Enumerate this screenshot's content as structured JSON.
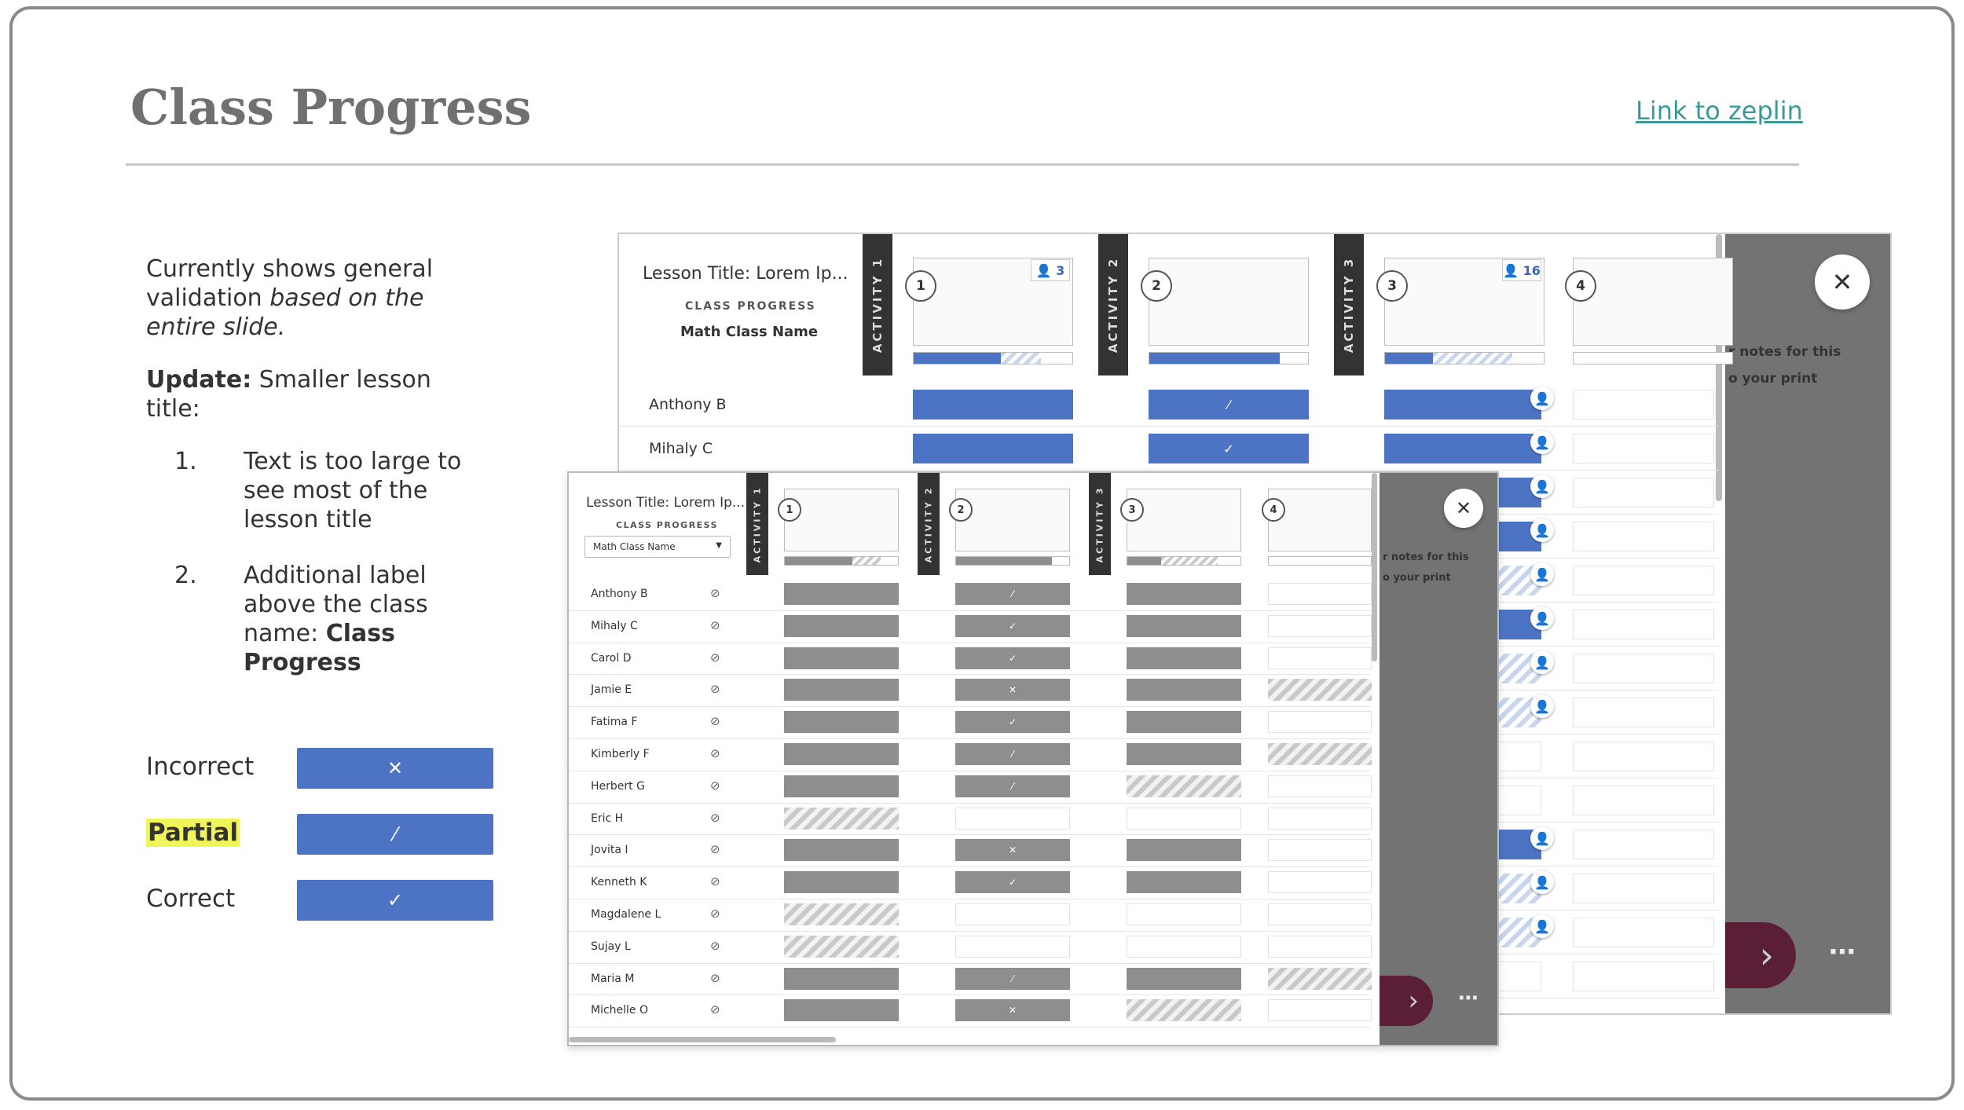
{
  "slide": {
    "title": "Class Progress",
    "link": "Link to zeplin"
  },
  "notes": {
    "p1a": "Currently shows general validation ",
    "p1b": "based on the entire slide.",
    "update_bold": "Update:",
    "update_text": " Smaller lesson title:",
    "items": [
      {
        "num": "1.",
        "text": "Text is too large to see most of the lesson title"
      },
      {
        "num": "2.",
        "text_a": "Additional label above the class name: ",
        "text_b": "Class Progress"
      }
    ]
  },
  "legend": [
    {
      "label": "Incorrect",
      "icon": "x-icon",
      "glyph": "✕"
    },
    {
      "label": "Partial",
      "icon": "slash-icon",
      "glyph": "⁄"
    },
    {
      "label": "Correct",
      "icon": "check-icon",
      "glyph": "✓"
    }
  ],
  "back_screen": {
    "lesson_title": "Lesson Title: Lorem Ip...",
    "sub_label": "CLASS PROGRESS",
    "class_name": "Math Class Name",
    "activities": [
      "ACTIVITY 1",
      "ACTIVITY 2",
      "ACTIVITY 3"
    ],
    "problems": [
      {
        "num": "1",
        "count": "3",
        "progress": 0.55,
        "partial": 0.25
      },
      {
        "num": "2",
        "progress": 0.82,
        "partial": 0
      },
      {
        "num": "3",
        "count": "16",
        "progress": 0.3,
        "partial": 0.5
      },
      {
        "num": "4",
        "progress": 0,
        "partial": 0
      }
    ],
    "students": [
      "Anthony B",
      "Mihaly C"
    ],
    "ghost_text_1": "r notes for this",
    "ghost_text_2": "o your print",
    "close_glyph": "✕",
    "more": "⋯"
  },
  "front_screen": {
    "lesson_title": "Lesson Title: Lorem Ip...",
    "sub_label": "CLASS PROGRESS",
    "class_select": "Math Class Name",
    "activities": [
      "ACTIVITY 1",
      "ACTIVITY 2",
      "ACTIVITY 3"
    ],
    "problems": [
      "1",
      "2",
      "3",
      "4"
    ],
    "ghost_text_1": "r notes for this",
    "ghost_text_2": "o your print",
    "close_glyph": "✕",
    "more": "⋯",
    "students": [
      {
        "name": "Anthony B",
        "cells": [
          "g",
          "g/",
          "g",
          "e"
        ]
      },
      {
        "name": "Mihaly C",
        "cells": [
          "g",
          "g✓",
          "g",
          "e"
        ]
      },
      {
        "name": "Carol D",
        "cells": [
          "g",
          "g✓",
          "g",
          "e"
        ]
      },
      {
        "name": "Jamie E",
        "cells": [
          "g",
          "g✕",
          "g",
          "h"
        ]
      },
      {
        "name": "Fatima F",
        "cells": [
          "g",
          "g✓",
          "g",
          "e"
        ]
      },
      {
        "name": "Kimberly F",
        "cells": [
          "g",
          "g/",
          "g",
          "h"
        ]
      },
      {
        "name": "Herbert G",
        "cells": [
          "g",
          "g/",
          "h",
          "e"
        ]
      },
      {
        "name": "Eric H",
        "cells": [
          "h",
          "e",
          "e",
          "e"
        ]
      },
      {
        "name": "Jovita I",
        "cells": [
          "g",
          "g✕",
          "g",
          "e"
        ]
      },
      {
        "name": "Kenneth K",
        "cells": [
          "g",
          "g✓",
          "g",
          "e"
        ]
      },
      {
        "name": "Magdalene L",
        "cells": [
          "h",
          "e",
          "e",
          "e"
        ]
      },
      {
        "name": "Sujay L",
        "cells": [
          "h",
          "e",
          "e",
          "e"
        ]
      },
      {
        "name": "Maria M",
        "cells": [
          "g",
          "g/",
          "g",
          "h"
        ]
      },
      {
        "name": "Michelle O",
        "cells": [
          "g",
          "g✕",
          "h",
          "e"
        ]
      }
    ]
  },
  "colors": {
    "accent": "#4d74c4",
    "gray_cell": "#8e8e8e",
    "panel": "#737373",
    "nav": "#5a1e36"
  }
}
